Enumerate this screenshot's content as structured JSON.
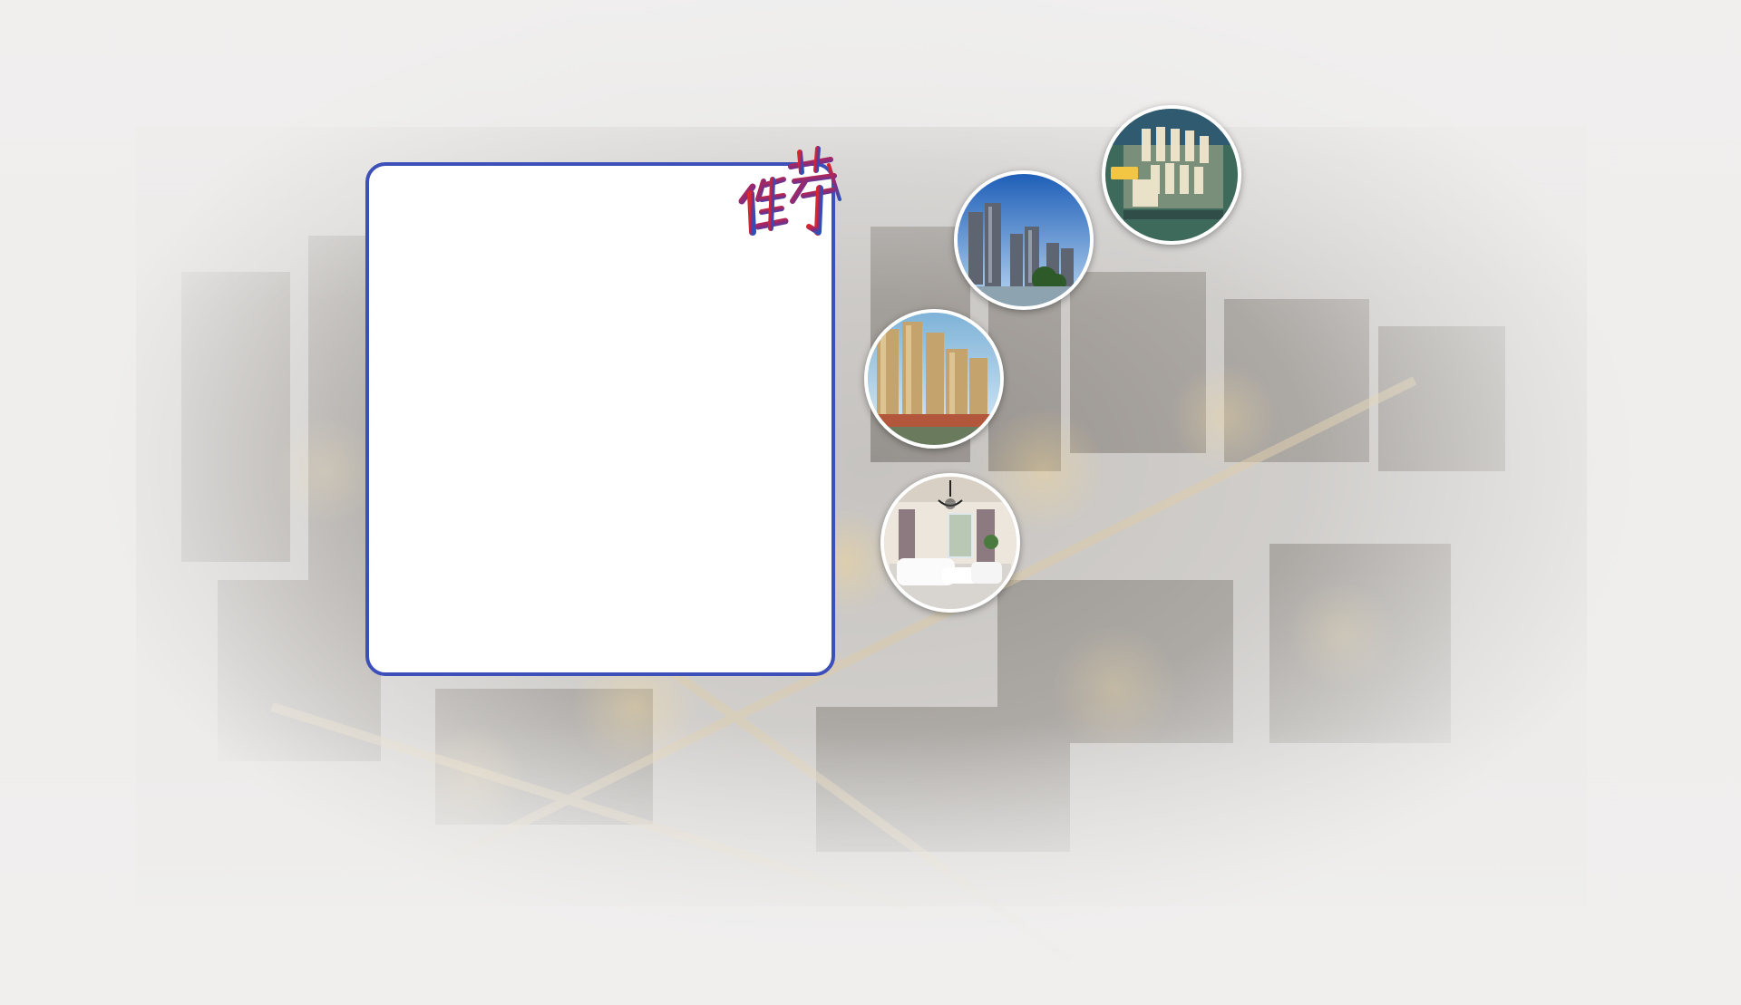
{
  "promo": {
    "stamp_text": "推荐",
    "panel_border_color": "#3d4fb8"
  },
  "gallery": {
    "items": [
      {
        "icon": "aerial-residential-complex-photo"
      },
      {
        "icon": "highrise-blue-sky-photo"
      },
      {
        "icon": "golden-apartment-towers-photo"
      },
      {
        "icon": "living-room-interior-photo"
      }
    ]
  }
}
